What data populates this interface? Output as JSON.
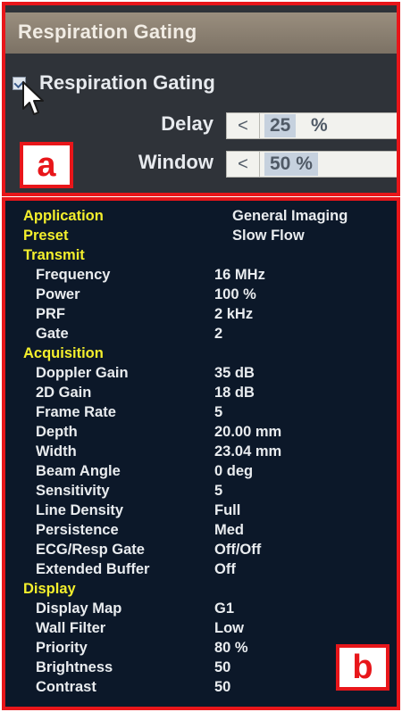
{
  "panel_a": {
    "title": "Respiration Gating",
    "checkbox_label": "Respiration Gating",
    "checkbox_checked": true,
    "delay": {
      "label": "Delay",
      "arrow": "<",
      "value": "25",
      "unit": "%"
    },
    "window": {
      "label": "Window",
      "arrow": "<",
      "value": "50 %"
    },
    "tag": "a"
  },
  "panel_b": {
    "tag": "b",
    "application": {
      "key": "Application",
      "value": "General Imaging"
    },
    "preset": {
      "key": "Preset",
      "value": "Slow Flow"
    },
    "transmit": {
      "heading": "Transmit",
      "items": [
        {
          "key": "Frequency",
          "value": "16 MHz"
        },
        {
          "key": "Power",
          "value": "100 %"
        },
        {
          "key": "PRF",
          "value": "2 kHz"
        },
        {
          "key": "Gate",
          "value": "2"
        }
      ]
    },
    "acquisition": {
      "heading": "Acquisition",
      "items": [
        {
          "key": "Doppler Gain",
          "value": "35 dB"
        },
        {
          "key": "2D Gain",
          "value": "18 dB"
        },
        {
          "key": "Frame Rate",
          "value": "5"
        },
        {
          "key": "Depth",
          "value": "20.00 mm"
        },
        {
          "key": "Width",
          "value": "23.04 mm"
        },
        {
          "key": "Beam Angle",
          "value": "0 deg"
        },
        {
          "key": "Sensitivity",
          "value": "5"
        },
        {
          "key": "Line Density",
          "value": "Full"
        },
        {
          "key": "Persistence",
          "value": "Med"
        },
        {
          "key": "ECG/Resp Gate",
          "value": "Off/Off"
        },
        {
          "key": "Extended Buffer",
          "value": "Off"
        }
      ]
    },
    "display": {
      "heading": "Display",
      "items": [
        {
          "key": "Display Map",
          "value": "G1"
        },
        {
          "key": "Wall Filter",
          "value": "Low"
        },
        {
          "key": "Priority",
          "value": "80 %"
        },
        {
          "key": "Brightness",
          "value": "50"
        },
        {
          "key": "Contrast",
          "value": "50"
        }
      ]
    }
  },
  "colors": {
    "frame_red": "#e8161a",
    "section_yellow": "#f4ef2c",
    "panel_navy": "#0c1829"
  }
}
